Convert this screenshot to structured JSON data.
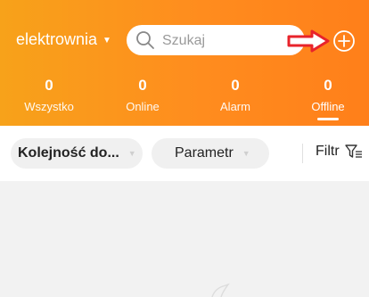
{
  "header": {
    "site_selector": "elektrownia",
    "search_placeholder": "Szukaj",
    "accent_color": "#ff8c1e",
    "annotation_color": "#e8232b"
  },
  "stats": [
    {
      "value": "0",
      "label": "Wszystko"
    },
    {
      "value": "0",
      "label": "Online"
    },
    {
      "value": "0",
      "label": "Alarm"
    },
    {
      "value": "0",
      "label": "Offline",
      "active": true
    }
  ],
  "filters": {
    "sort_label": "Kolejność do...",
    "param_label": "Parametr",
    "filter_label": "Filtr"
  },
  "icons": [
    "caret-down-icon",
    "search-icon",
    "red-arrow-annotation",
    "add-circle-icon",
    "filter-icon"
  ]
}
